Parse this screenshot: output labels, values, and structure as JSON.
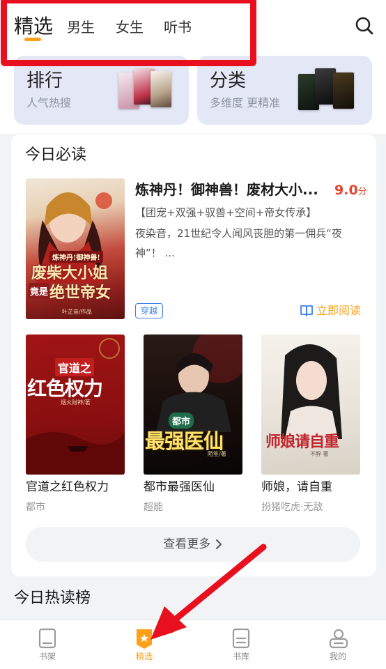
{
  "header": {
    "tabs": [
      {
        "label": "精选",
        "active": true
      },
      {
        "label": "男生",
        "active": false
      },
      {
        "label": "女生",
        "active": false
      },
      {
        "label": "听书",
        "active": false
      }
    ],
    "search_icon": "search-icon"
  },
  "quick_cards": [
    {
      "title": "排行",
      "subtitle": "人气热搜"
    },
    {
      "title": "分类",
      "subtitle": "多维度 更精准"
    }
  ],
  "daily": {
    "section_title": "今日必读",
    "featured": {
      "title": "炼神丹！御神兽！废材大小...",
      "score": "9.0",
      "score_unit": "分",
      "tags": "【团宠+双强+驭兽+空间+帝女传承】",
      "description": "夜染音，21世纪令人闻风丧胆的第一佣兵“夜神”！ ...",
      "genre": "穿越",
      "read_label": "立即阅读",
      "cover_lines": [
        "炼神丹!御神兽!",
        "废柴大小姐",
        "竟是",
        "绝世帝女",
        "叶芷音/作品"
      ]
    },
    "books": [
      {
        "name": "官道之红色权力",
        "category": "都市",
        "cover_lines": [
          "官道之",
          "红色权力",
          "烟火财神/著"
        ]
      },
      {
        "name": "都市最强医仙",
        "category": "超能",
        "cover_lines": [
          "都市",
          "最强医仙",
          "陌笙/著"
        ]
      },
      {
        "name": "师娘，请自重",
        "category": "扮猪吃虎·无敌",
        "cover_lines": [
          "师娘请自重",
          "不醉 著"
        ]
      }
    ],
    "more_label": "查看更多",
    "more_icon": "chevron-right-icon"
  },
  "hot": {
    "section_title": "今日热读榜"
  },
  "bottom_nav": [
    {
      "label": "书架",
      "icon": "bookshelf-icon",
      "active": false
    },
    {
      "label": "精选",
      "icon": "featured-icon",
      "active": true
    },
    {
      "label": "书库",
      "icon": "library-icon",
      "active": false
    },
    {
      "label": "我的",
      "icon": "profile-icon",
      "active": false
    }
  ],
  "colors": {
    "accent": "#ffa018",
    "score": "#e8462c",
    "highlight_box": "#e8101e",
    "genre_badge": "#3d7ff0",
    "card_bg": "#e4e8f6"
  }
}
